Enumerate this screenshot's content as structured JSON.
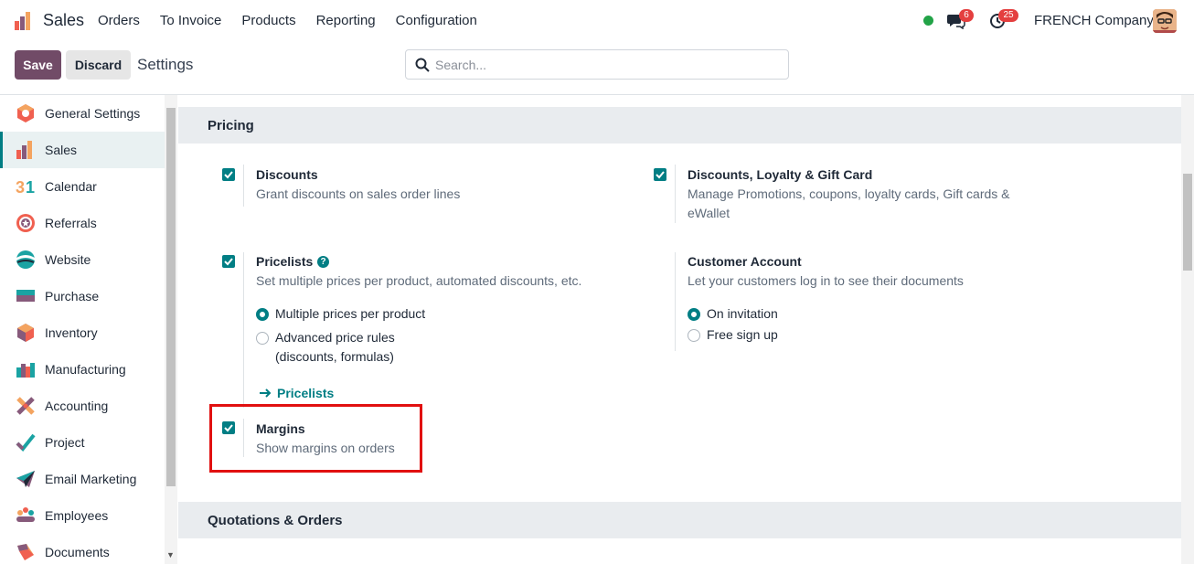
{
  "navbar": {
    "app_name": "Sales",
    "menu": [
      "Orders",
      "To Invoice",
      "Products",
      "Reporting",
      "Configuration"
    ],
    "messages_badge": "6",
    "activities_badge": "25",
    "company": "FRENCH Company",
    "status_color": "#22a347"
  },
  "control": {
    "save_label": "Save",
    "discard_label": "Discard",
    "breadcrumb": "Settings",
    "search_placeholder": "Search..."
  },
  "sidebar": {
    "items": [
      {
        "label": "General Settings",
        "icon": "general-settings-icon"
      },
      {
        "label": "Sales",
        "icon": "sales-icon",
        "active": true
      },
      {
        "label": "Calendar",
        "icon": "calendar-icon"
      },
      {
        "label": "Referrals",
        "icon": "referrals-icon"
      },
      {
        "label": "Website",
        "icon": "website-icon"
      },
      {
        "label": "Purchase",
        "icon": "purchase-icon"
      },
      {
        "label": "Inventory",
        "icon": "inventory-icon"
      },
      {
        "label": "Manufacturing",
        "icon": "manufacturing-icon"
      },
      {
        "label": "Accounting",
        "icon": "accounting-icon"
      },
      {
        "label": "Project",
        "icon": "project-icon"
      },
      {
        "label": "Email Marketing",
        "icon": "email-marketing-icon"
      },
      {
        "label": "Employees",
        "icon": "employees-icon"
      },
      {
        "label": "Documents",
        "icon": "documents-icon"
      }
    ]
  },
  "pricing": {
    "title": "Pricing",
    "discounts": {
      "title": "Discounts",
      "desc": "Grant discounts on sales order lines",
      "checked": true
    },
    "loyalty": {
      "title": "Discounts, Loyalty & Gift Card",
      "desc": "Manage Promotions, coupons, loyalty cards, Gift cards & eWallet",
      "checked": true
    },
    "pricelists": {
      "title": "Pricelists",
      "help": "?",
      "desc": "Set multiple prices per product, automated discounts, etc.",
      "checked": true,
      "option1": "Multiple prices per product",
      "option2": "Advanced price rules (discounts, formulas)",
      "link": "Pricelists"
    },
    "customer_account": {
      "title": "Customer Account",
      "desc": "Let your customers log in to see their documents",
      "option1": "On invitation",
      "option2": "Free sign up"
    },
    "margins": {
      "title": "Margins",
      "desc": "Show margins on orders",
      "checked": true
    }
  },
  "quotations": {
    "title": "Quotations & Orders"
  },
  "colors": {
    "brand": "#714b67",
    "accent": "#017e84",
    "highlight": "#e11010"
  }
}
